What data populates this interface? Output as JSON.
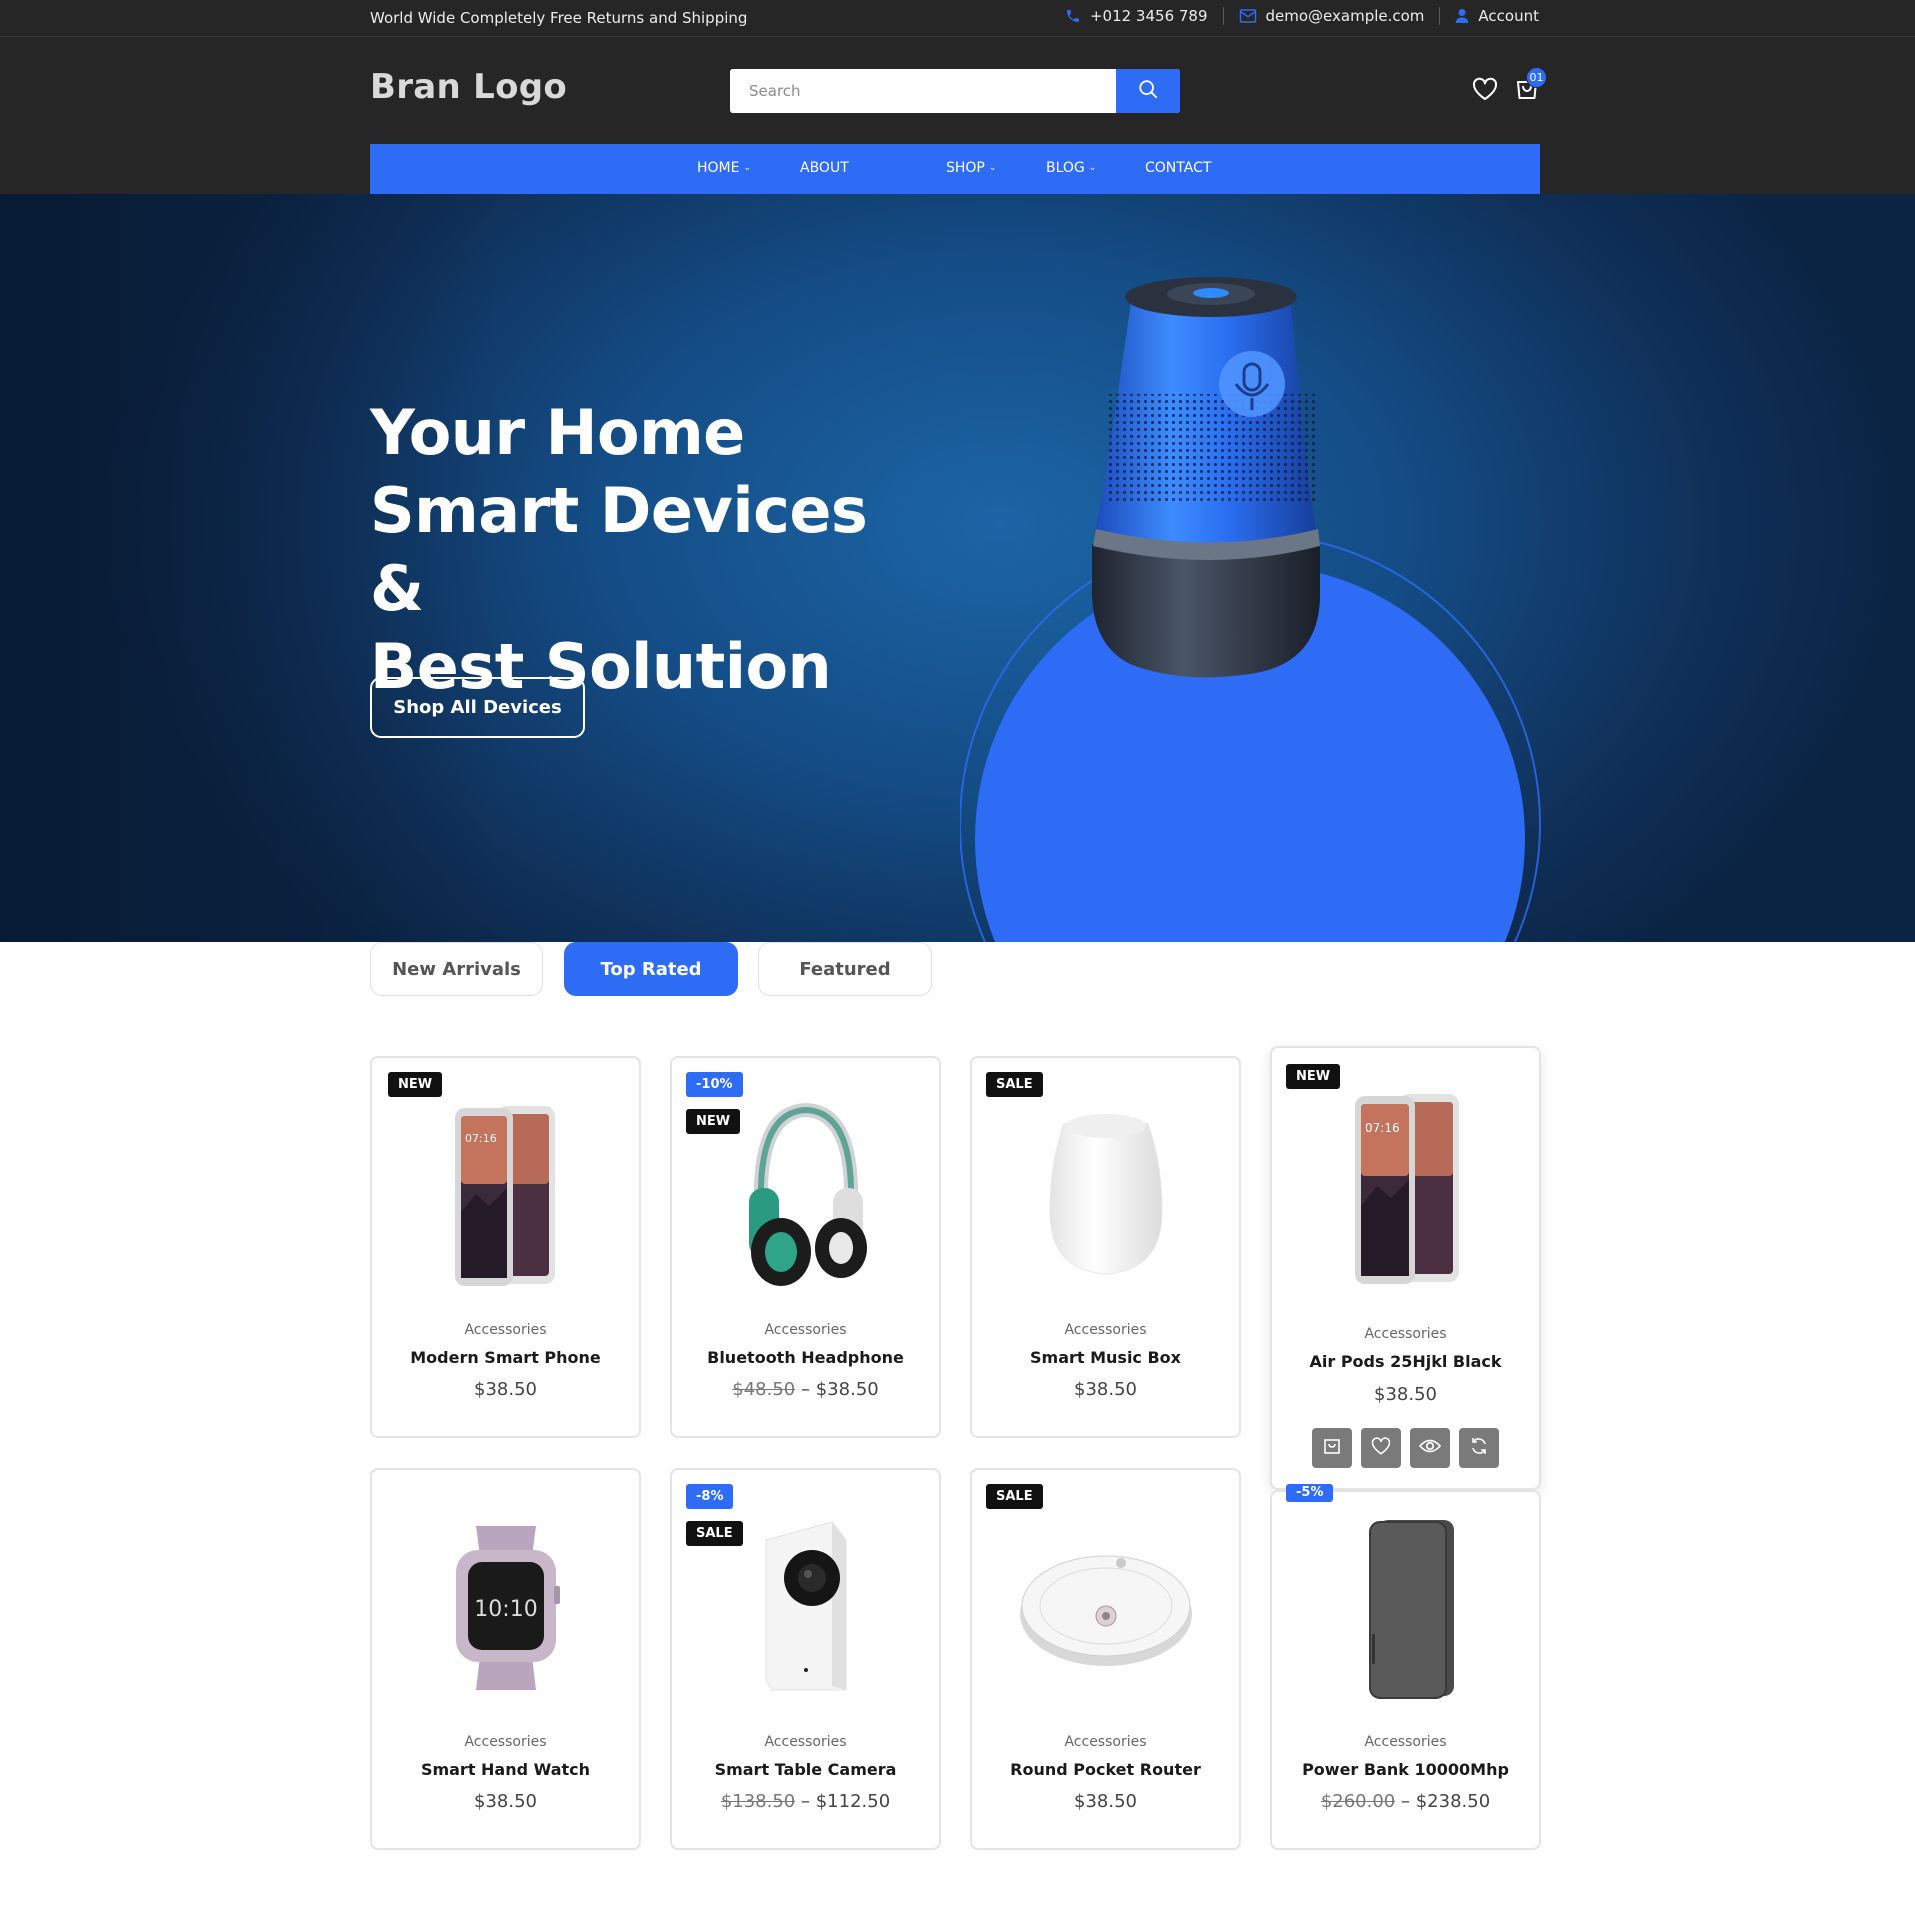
{
  "topbar": {
    "promo": "World Wide Completely Free Returns and Shipping",
    "phone": "+012 3456 789",
    "email": "demo@example.com",
    "account": "Account"
  },
  "header": {
    "logo": "Bran Logo",
    "search_placeholder": "Search",
    "cart_count": "01"
  },
  "nav": {
    "items": [
      {
        "label": "HOME",
        "has_dropdown": true
      },
      {
        "label": "ABOUT",
        "has_dropdown": false
      },
      {
        "label": "SHOP",
        "has_dropdown": true
      },
      {
        "label": "BLOG",
        "has_dropdown": true
      },
      {
        "label": "CONTACT",
        "has_dropdown": false
      }
    ]
  },
  "hero": {
    "title_lines": [
      "Your Home",
      "Smart Devices &",
      "Best Solution"
    ],
    "cta": "Shop All Devices"
  },
  "tabs": [
    {
      "label": "New Arrivals",
      "active": false
    },
    {
      "label": "Top Rated",
      "active": true
    },
    {
      "label": "Featured",
      "active": false
    }
  ],
  "products": [
    {
      "category": "Accessories",
      "name": "Modern Smart Phone",
      "price": "$38.50",
      "old_price": "",
      "badges": [
        "NEW"
      ],
      "icon": "smartphone-image"
    },
    {
      "category": "Accessories",
      "name": "Bluetooth Headphone",
      "price": "$38.50",
      "old_price": "$48.50",
      "badges": [
        "-10%",
        "NEW"
      ],
      "icon": "headphone-image"
    },
    {
      "category": "Accessories",
      "name": "Smart Music Box",
      "price": "$38.50",
      "old_price": "",
      "badges": [
        "SALE"
      ],
      "icon": "speaker-image"
    },
    {
      "category": "Accessories",
      "name": "Air Pods 25Hjkl Black",
      "price": "$38.50",
      "old_price": "",
      "badges": [
        "NEW"
      ],
      "icon": "smartphone-image"
    },
    {
      "category": "Accessories",
      "name": "Smart Hand Watch",
      "price": "$38.50",
      "old_price": "",
      "badges": [],
      "icon": "smartwatch-image"
    },
    {
      "category": "Accessories",
      "name": "Smart Table Camera",
      "price": "$112.50",
      "old_price": "$138.50",
      "badges": [
        "-8%",
        "SALE"
      ],
      "icon": "camera-image"
    },
    {
      "category": "Accessories",
      "name": "Round Pocket Router",
      "price": "$38.50",
      "old_price": "",
      "badges": [
        "SALE"
      ],
      "icon": "robot-vacuum-image"
    },
    {
      "category": "Accessories",
      "name": "Power Bank 10000Mhp",
      "price": "$238.50",
      "old_price": "$260.00",
      "badges": [
        "-5%"
      ],
      "icon": "powerbank-image"
    }
  ],
  "colors": {
    "accent": "#2e6cf6",
    "dark": "#262626",
    "badge_dark": "#111111"
  }
}
